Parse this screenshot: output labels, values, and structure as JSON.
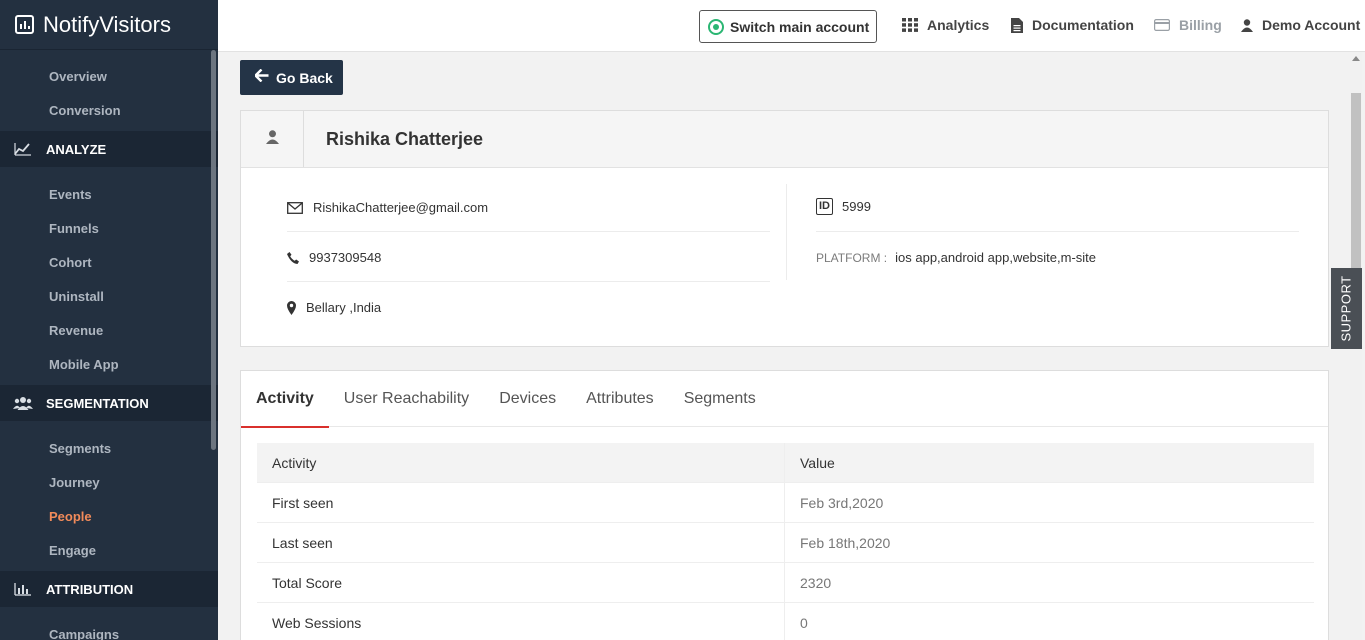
{
  "brand": {
    "name": "NotifyVisitors"
  },
  "sidebar": {
    "items_top": [
      "Overview",
      "Conversion"
    ],
    "analyze": {
      "label": "ANALYZE",
      "items": [
        "Events",
        "Funnels",
        "Cohort",
        "Uninstall",
        "Revenue",
        "Mobile App"
      ]
    },
    "segmentation": {
      "label": "SEGMENTATION",
      "items": [
        "Segments",
        "Journey",
        "People",
        "Engage"
      ]
    },
    "attribution": {
      "label": "ATTRIBUTION",
      "items": [
        "Campaigns"
      ]
    },
    "active_item": "People",
    "accent_color": "#f28b5a"
  },
  "topbar": {
    "switch_account": "Switch main account",
    "analytics": "Analytics",
    "documentation": "Documentation",
    "billing": "Billing",
    "account": "Demo Account"
  },
  "go_back": "Go Back",
  "profile": {
    "name": "Rishika Chatterjee",
    "email": "RishikaChatterjee@gmail.com",
    "phone": "9937309548",
    "location": "Bellary ,India",
    "id_label": "ID",
    "id": "5999",
    "platform_label": "PLATFORM :",
    "platform": "ios app,android app,website,m-site"
  },
  "tabs": [
    "Activity",
    "User Reachability",
    "Devices",
    "Attributes",
    "Segments"
  ],
  "activity_table": {
    "headers": [
      "Activity",
      "Value"
    ],
    "rows": [
      [
        "First seen",
        "Feb 3rd,2020"
      ],
      [
        "Last seen",
        "Feb 18th,2020"
      ],
      [
        "Total Score",
        "2320"
      ],
      [
        "Web Sessions",
        "0"
      ]
    ]
  },
  "support": "SUPPORT"
}
